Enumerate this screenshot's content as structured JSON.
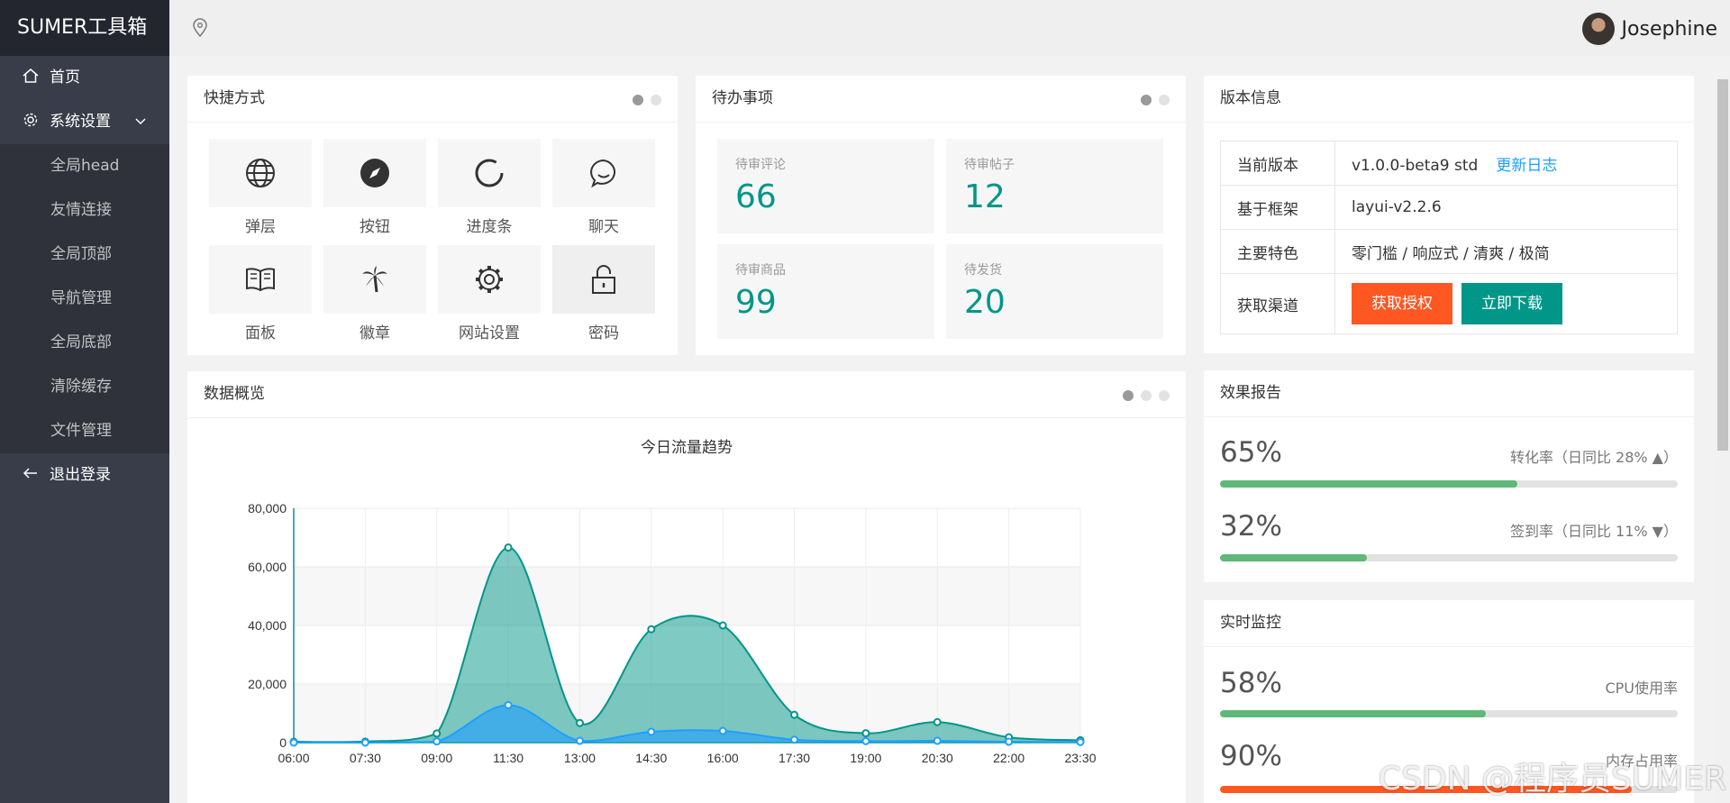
{
  "app": {
    "logo": "SUMER工具箱"
  },
  "header": {
    "user_name": "Josephine",
    "location_icon": "location-pin-icon"
  },
  "sidebar": {
    "items": [
      {
        "label": "首页",
        "icon": "home-icon"
      },
      {
        "label": "系统设置",
        "icon": "gear-icon",
        "expanded": true
      },
      {
        "label": "退出登录",
        "icon": "arrow-left-icon"
      }
    ],
    "submenu": [
      "全局head",
      "友情连接",
      "全局顶部",
      "导航管理",
      "全局底部",
      "清除缓存",
      "文件管理"
    ]
  },
  "shortcuts": {
    "title": "快捷方式",
    "items": [
      {
        "label": "弹层",
        "icon": "globe-icon"
      },
      {
        "label": "按钮",
        "icon": "compass-icon"
      },
      {
        "label": "进度条",
        "icon": "loading-ring-icon"
      },
      {
        "label": "聊天",
        "icon": "chat-bubble-icon"
      },
      {
        "label": "面板",
        "icon": "book-icon"
      },
      {
        "label": "徽章",
        "icon": "palm-tree-icon"
      },
      {
        "label": "网站设置",
        "icon": "settings-icon"
      },
      {
        "label": "密码",
        "icon": "unlock-icon"
      }
    ]
  },
  "todo": {
    "title": "待办事项",
    "items": [
      {
        "label": "待审评论",
        "value": "66"
      },
      {
        "label": "待审帖子",
        "value": "12"
      },
      {
        "label": "待审商品",
        "value": "99"
      },
      {
        "label": "待发货",
        "value": "20"
      }
    ]
  },
  "version": {
    "title": "版本信息",
    "rows": [
      {
        "key": "当前版本",
        "value": "v1.0.0-beta9 std",
        "link": "更新日志"
      },
      {
        "key": "基于框架",
        "value": "layui-v2.2.6"
      },
      {
        "key": "主要特色",
        "value": "零门槛 / 响应式 / 清爽 / 极简"
      },
      {
        "key": "获取渠道"
      }
    ],
    "buttons": {
      "get_license": "获取授权",
      "download": "立即下载"
    },
    "colors": {
      "orange": "#ff5722",
      "green": "#009688"
    }
  },
  "overview": {
    "title": "数据概览",
    "chart_title": "今日流量趋势"
  },
  "chart_data": {
    "type": "area",
    "title": "今日流量趋势",
    "x": [
      "06:00",
      "07:30",
      "09:00",
      "11:30",
      "13:00",
      "14:30",
      "16:00",
      "17:30",
      "19:00",
      "20:30",
      "22:00",
      "23:30"
    ],
    "ylim": [
      0,
      80000
    ],
    "yticks": [
      "0",
      "20,000",
      "40,000",
      "60,000",
      "80,000"
    ],
    "series": [
      {
        "values": [
          290,
          330,
          3100,
          66600,
          6700,
          38700,
          40000,
          9500,
          3200,
          7000,
          1800,
          800
        ],
        "color": "#009688"
      },
      {
        "values": [
          0,
          0,
          400,
          12800,
          600,
          3700,
          4000,
          1000,
          500,
          600,
          300,
          200
        ],
        "color": "#1e9fff"
      }
    ],
    "grid": true,
    "legend": "none"
  },
  "effect_report": {
    "title": "效果报告",
    "items": [
      {
        "value": "65%",
        "percent": 65,
        "note": "转化率（日同比 28%",
        "trend": "up",
        "color": "#5fb878"
      },
      {
        "value": "32%",
        "percent": 32,
        "note": "签到率（日同比 11%",
        "trend": "down",
        "color": "#5fb878"
      }
    ]
  },
  "monitor": {
    "title": "实时监控",
    "items": [
      {
        "value": "58%",
        "percent": 58,
        "note": "CPU使用率",
        "color": "#5fb878"
      },
      {
        "value": "90%",
        "percent": 90,
        "note": "内存占用率",
        "color": "#ff5722"
      }
    ]
  },
  "watermark": "CSDN @程序员SUMER"
}
